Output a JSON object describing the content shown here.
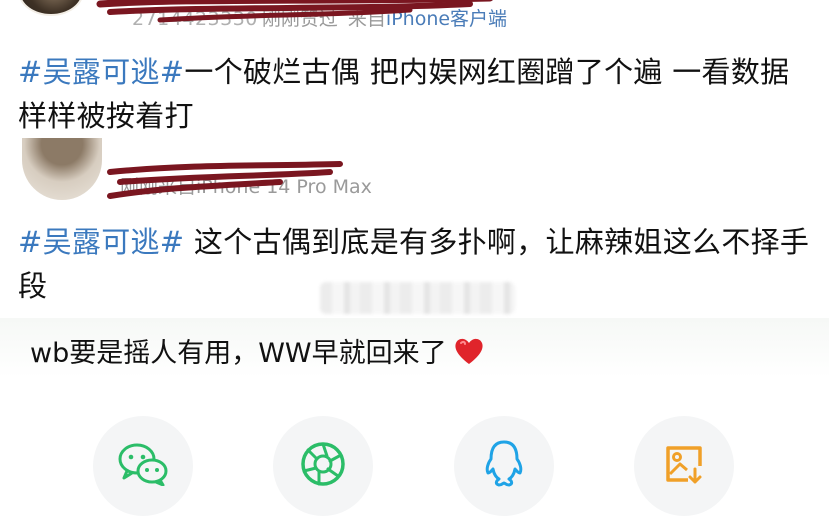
{
  "post1": {
    "user_id": "2714423330",
    "time": "刚刚赞过",
    "source_prefix": "来自",
    "device": "iPhone客户端",
    "hashtag": "#吴露可逃#",
    "text": "一个破烂古偶 把内娱网红圈蹭了个遍 一看数据样样被按着打"
  },
  "post2": {
    "time": "刚刚",
    "source_prefix": "来自",
    "device": "iPhone 14 Pro Max",
    "hashtag": "#吴露可逃#",
    "text": " 这个古偶到底是有多扑啊，让麻辣姐这么不择手段"
  },
  "comment": {
    "text": "wb要是摇人有用，WW早就回来了",
    "emoji": "red-heart-icon"
  },
  "share": {
    "items": [
      {
        "icon": "wechat-icon",
        "color": "#2bbd68"
      },
      {
        "icon": "moments-icon",
        "color": "#2bbd68"
      },
      {
        "icon": "qq-icon",
        "color": "#1fa3e6"
      },
      {
        "icon": "save-image-icon",
        "color": "#f0a028"
      }
    ]
  },
  "colors": {
    "hashtag": "#3b79be",
    "meta": "#9a9a9a",
    "scribble": "#7a1620"
  }
}
